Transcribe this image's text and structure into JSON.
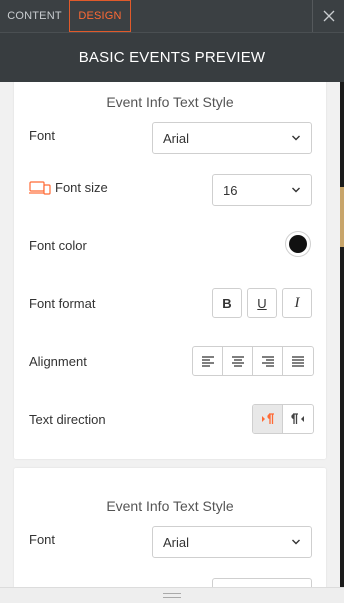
{
  "tabs": {
    "content": "CONTENT",
    "design": "DESIGN"
  },
  "header": {
    "title": "BASIC EVENTS PREVIEW"
  },
  "section1": {
    "title": "Event Info Text Style",
    "font_label": "Font",
    "font_value": "Arial",
    "font_size_label": "Font size",
    "font_size_value": "16",
    "font_color_label": "Font color",
    "font_color": "#111111",
    "font_format_label": "Font format",
    "format_buttons": {
      "bold": "B",
      "underline": "U",
      "italic": "I"
    },
    "alignment_label": "Alignment",
    "text_direction_label": "Text direction"
  },
  "section2": {
    "title": "Event Info Text Style",
    "font_label": "Font",
    "font_value": "Arial"
  },
  "colors": {
    "accent": "#ff6a35",
    "header_bg": "#383d40",
    "topbar_bg": "#3b4043"
  },
  "icons": [
    "close-icon",
    "chevron-down-icon",
    "responsive-devices-icon",
    "align-left-icon",
    "align-center-icon",
    "align-right-icon",
    "align-justify-icon",
    "ltr-direction-icon",
    "rtl-direction-icon",
    "resize-grip-icon"
  ]
}
